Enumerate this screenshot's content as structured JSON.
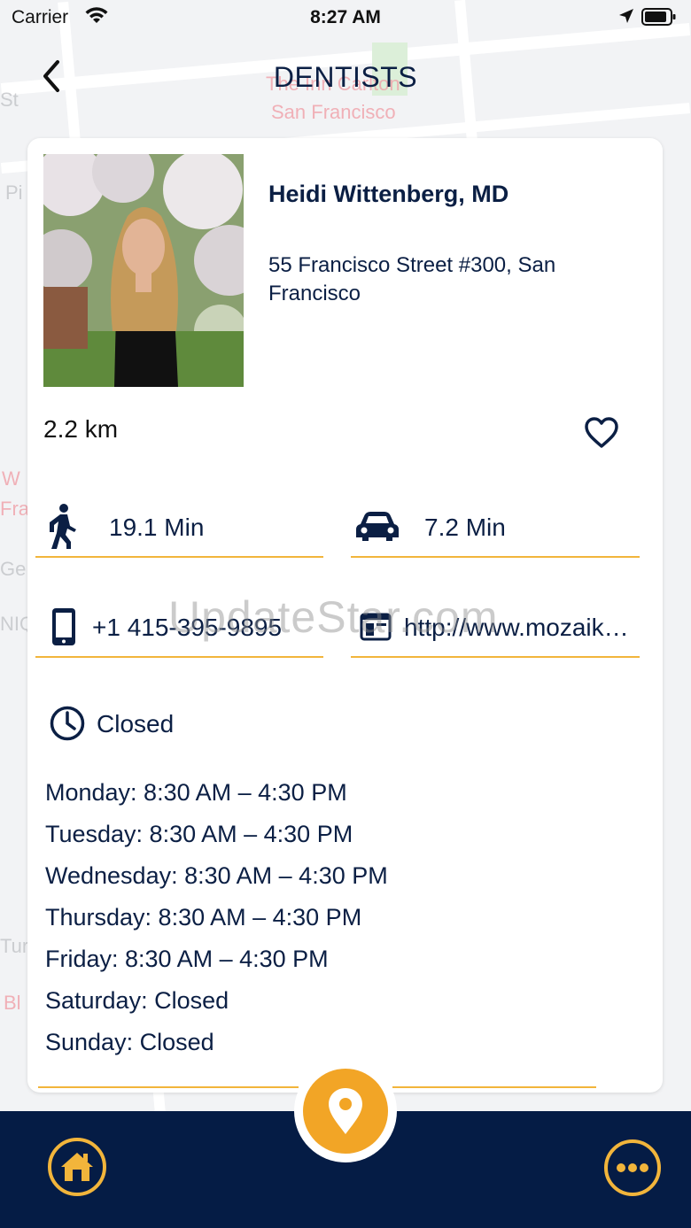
{
  "status_bar": {
    "carrier": "Carrier",
    "time": "8:27 AM"
  },
  "header": {
    "title": "DENTISTS"
  },
  "map_labels": {
    "hotel_line1": "The Inn Carlton",
    "hotel_line2": "San Francisco"
  },
  "provider": {
    "name": "Heidi Wittenberg, MD",
    "address": "55 Francisco Street #300, San Francisco",
    "distance": "2.2 km",
    "walk_time": "19.1 Min",
    "drive_time": "7.2 Min",
    "phone": "+1 415-395-9895",
    "website": "http://www.mozaikdentistry.com",
    "open_status": "Closed",
    "hours": [
      "Monday: 8:30 AM – 4:30 PM",
      "Tuesday: 8:30 AM – 4:30 PM",
      "Wednesday: 8:30 AM – 4:30 PM",
      "Thursday: 8:30 AM – 4:30 PM",
      "Friday: 8:30 AM – 4:30 PM",
      "Saturday: Closed",
      "Sunday: Closed"
    ]
  },
  "watermark": "UpdateStar.com",
  "colors": {
    "navy": "#0b1f44",
    "accent": "#f2b53b",
    "fab": "#f2a526",
    "nav_bg": "#051c45"
  },
  "icons": [
    "back-chevron-icon",
    "heart-icon",
    "walking-icon",
    "car-icon",
    "phone-icon",
    "web-icon",
    "clock-icon",
    "location-pin-icon",
    "home-icon",
    "more-icon"
  ]
}
